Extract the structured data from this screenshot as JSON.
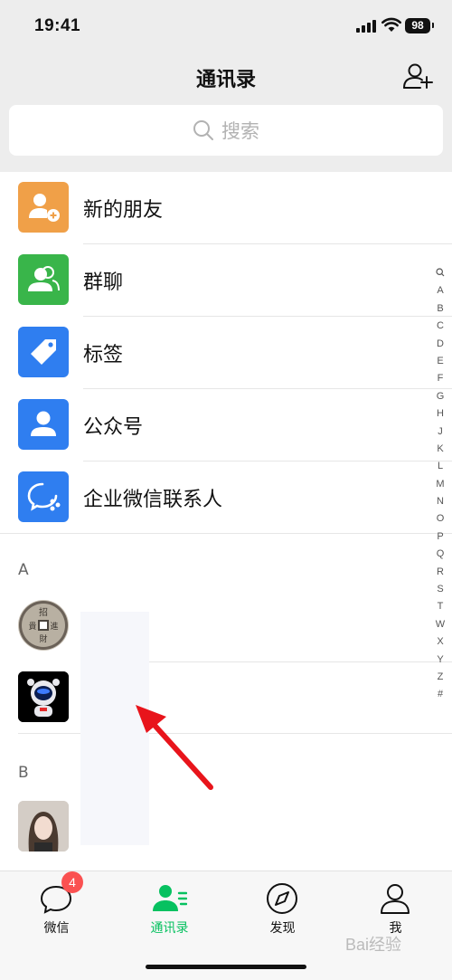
{
  "status": {
    "time": "19:41",
    "battery": "98"
  },
  "header": {
    "title": "通讯录"
  },
  "search": {
    "placeholder": "搜索"
  },
  "menu": [
    {
      "label": "新的朋友",
      "icon": "add-friend-icon",
      "color": "#f0a048"
    },
    {
      "label": "群聊",
      "icon": "group-icon",
      "color": "#39b54a"
    },
    {
      "label": "标签",
      "icon": "tag-icon",
      "color": "#2f7ef0"
    },
    {
      "label": "公众号",
      "icon": "official-account-icon",
      "color": "#2f7ef0"
    },
    {
      "label": "企业微信联系人",
      "icon": "wecom-icon",
      "color": "#2f7ef0"
    }
  ],
  "sections": [
    {
      "letter": "A"
    },
    {
      "letter": "B"
    }
  ],
  "index": [
    "A",
    "B",
    "C",
    "D",
    "E",
    "F",
    "G",
    "H",
    "J",
    "K",
    "L",
    "M",
    "N",
    "O",
    "P",
    "Q",
    "R",
    "S",
    "T",
    "W",
    "X",
    "Y",
    "Z",
    "#"
  ],
  "tabs": [
    {
      "label": "微信",
      "badge": "4"
    },
    {
      "label": "通讯录"
    },
    {
      "label": "发现"
    },
    {
      "label": "我"
    }
  ],
  "colors": {
    "accent": "#07c160",
    "badge": "#fa5151",
    "arrow": "#e8141b"
  },
  "watermark": "Bai经验"
}
